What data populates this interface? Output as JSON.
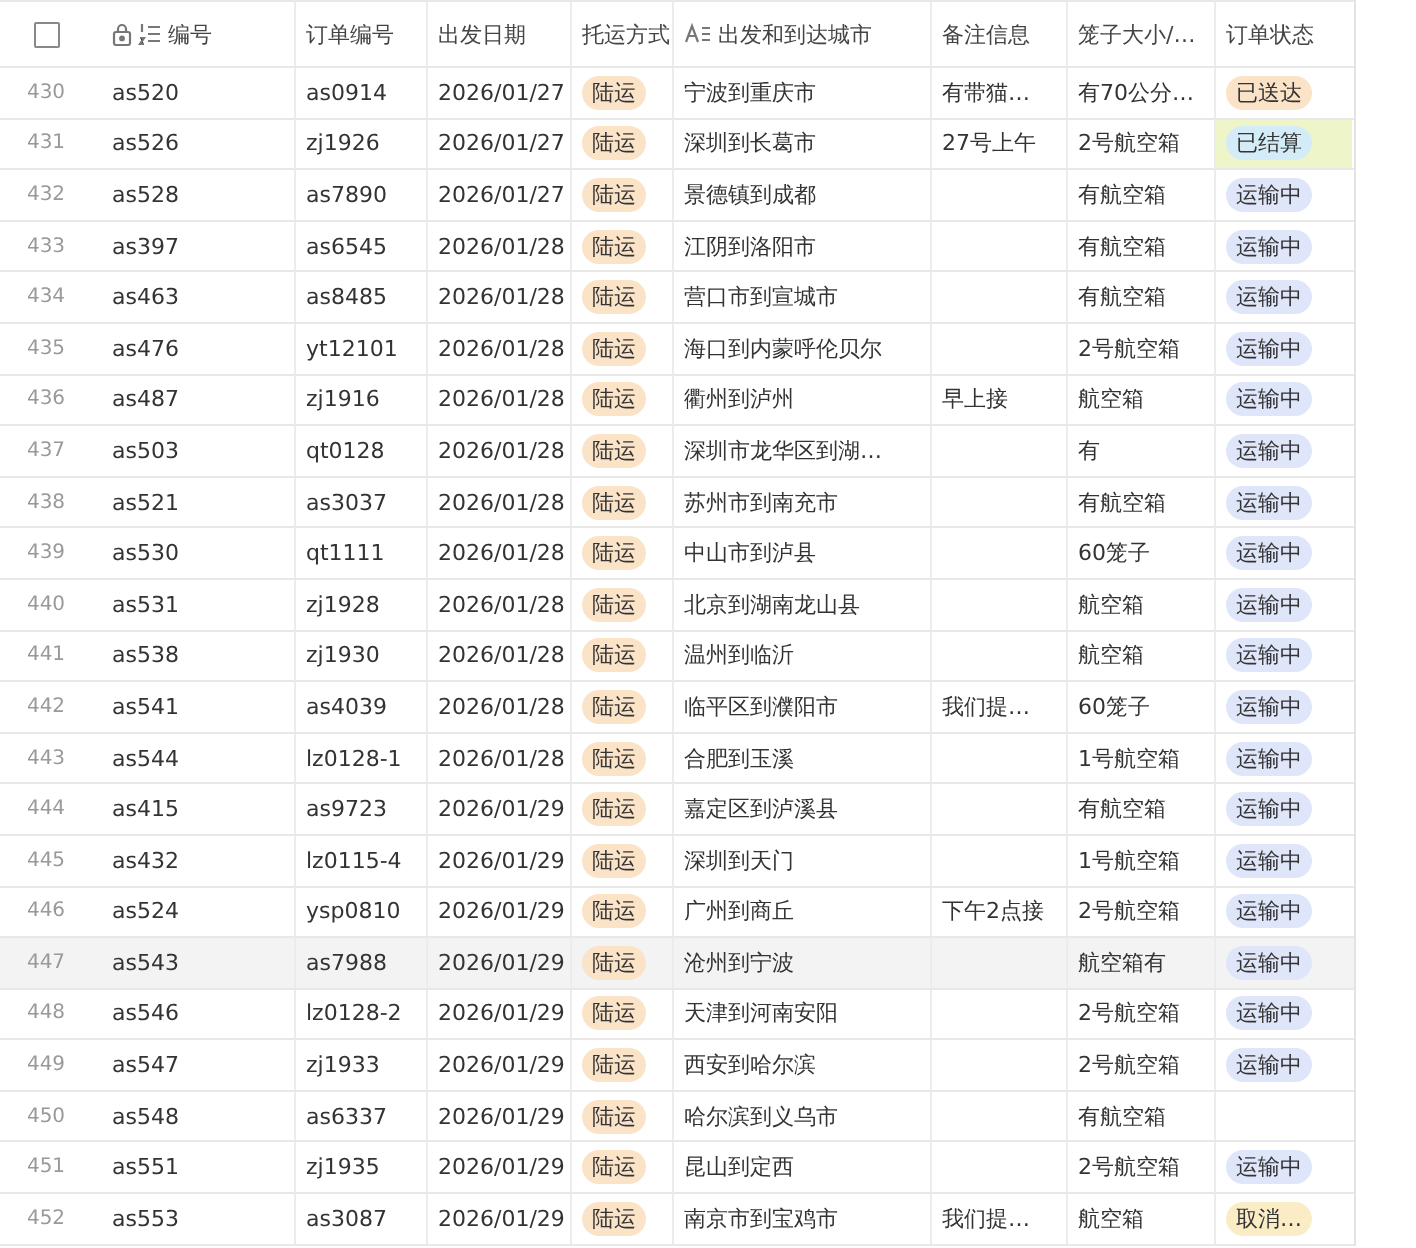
{
  "table": {
    "columns": [
      {
        "label": "编号",
        "kind": "number"
      },
      {
        "label": "订单编号",
        "kind": "plain"
      },
      {
        "label": "出发日期",
        "kind": "plain"
      },
      {
        "label": "托运方式",
        "kind": "plain"
      },
      {
        "label": "出发和到达城市",
        "kind": "text"
      },
      {
        "label": "备注信息",
        "kind": "plain"
      },
      {
        "label": "笼子大小/…",
        "kind": "plain"
      },
      {
        "label": "订单状态",
        "kind": "plain"
      }
    ],
    "header_checkbox": {
      "checked": false
    },
    "rows": [
      {
        "index": "430",
        "id": "as520",
        "order": "as0914",
        "date": "2026/01/27",
        "method": "陆运",
        "route": "宁波到重庆市",
        "note": "有带猫…",
        "cage": "有70公分…",
        "status": {
          "label": "已送达",
          "color": "#fbe3c8",
          "highlighted": false
        },
        "hovered": false
      },
      {
        "index": "431",
        "id": "as526",
        "order": "zj1926",
        "date": "2026/01/27",
        "method": "陆运",
        "route": "深圳到长葛市",
        "note": "27号上午",
        "cage": "2号航空箱",
        "status": {
          "label": "已结算",
          "color": "#d4ecf7",
          "highlighted": true
        },
        "hovered": false
      },
      {
        "index": "432",
        "id": "as528",
        "order": "as7890",
        "date": "2026/01/27",
        "method": "陆运",
        "route": "景德镇到成都",
        "cage": "有航空箱",
        "status": {
          "label": "运输中",
          "color": "#dfe6fa",
          "highlighted": false
        },
        "hovered": false
      },
      {
        "index": "433",
        "id": "as397",
        "order": "as6545",
        "date": "2026/01/28",
        "method": "陆运",
        "route": "江阴到洛阳市",
        "cage": "有航空箱",
        "status": {
          "label": "运输中",
          "color": "#dfe6fa",
          "highlighted": false
        },
        "hovered": false
      },
      {
        "index": "434",
        "id": "as463",
        "order": "as8485",
        "date": "2026/01/28",
        "method": "陆运",
        "route": "营口市到宣城市",
        "cage": "有航空箱",
        "status": {
          "label": "运输中",
          "color": "#dfe6fa",
          "highlighted": false
        },
        "hovered": false
      },
      {
        "index": "435",
        "id": "as476",
        "order": "yt12101",
        "date": "2026/01/28",
        "method": "陆运",
        "route": "海口到内蒙呼伦贝尔",
        "cage": "2号航空箱",
        "status": {
          "label": "运输中",
          "color": "#dfe6fa",
          "highlighted": false
        },
        "hovered": false
      },
      {
        "index": "436",
        "id": "as487",
        "order": "zj1916",
        "date": "2026/01/28",
        "method": "陆运",
        "route": "衢州到泸州",
        "note": "早上接",
        "cage": "航空箱",
        "status": {
          "label": "运输中",
          "color": "#dfe6fa",
          "highlighted": false
        },
        "hovered": false
      },
      {
        "index": "437",
        "id": "as503",
        "order": "qt0128",
        "date": "2026/01/28",
        "method": "陆运",
        "route": "深圳市龙华区到湖…",
        "cage": "有",
        "status": {
          "label": "运输中",
          "color": "#dfe6fa",
          "highlighted": false
        },
        "hovered": false
      },
      {
        "index": "438",
        "id": "as521",
        "order": "as3037",
        "date": "2026/01/28",
        "method": "陆运",
        "route": "苏州市到南充市",
        "cage": "有航空箱",
        "status": {
          "label": "运输中",
          "color": "#dfe6fa",
          "highlighted": false
        },
        "hovered": false
      },
      {
        "index": "439",
        "id": "as530",
        "order": "qt1111",
        "date": "2026/01/28",
        "method": "陆运",
        "route": "中山市到泸县",
        "cage": "60笼子",
        "status": {
          "label": "运输中",
          "color": "#dfe6fa",
          "highlighted": false
        },
        "hovered": false
      },
      {
        "index": "440",
        "id": "as531",
        "order": "zj1928",
        "date": "2026/01/28",
        "method": "陆运",
        "route": "北京到湖南龙山县",
        "cage": "航空箱",
        "status": {
          "label": "运输中",
          "color": "#dfe6fa",
          "highlighted": false
        },
        "hovered": false
      },
      {
        "index": "441",
        "id": "as538",
        "order": "zj1930",
        "date": "2026/01/28",
        "method": "陆运",
        "route": "温州到临沂",
        "cage": "航空箱",
        "status": {
          "label": "运输中",
          "color": "#dfe6fa",
          "highlighted": false
        },
        "hovered": false
      },
      {
        "index": "442",
        "id": "as541",
        "order": "as4039",
        "date": "2026/01/28",
        "method": "陆运",
        "route": "临平区到濮阳市",
        "note": "我们提…",
        "cage": "60笼子",
        "status": {
          "label": "运输中",
          "color": "#dfe6fa",
          "highlighted": false
        },
        "hovered": false
      },
      {
        "index": "443",
        "id": "as544",
        "order": "lz0128-1",
        "date": "2026/01/28",
        "method": "陆运",
        "route": "合肥到玉溪",
        "cage": "1号航空箱",
        "status": {
          "label": "运输中",
          "color": "#dfe6fa",
          "highlighted": false
        },
        "hovered": false
      },
      {
        "index": "444",
        "id": "as415",
        "order": "as9723",
        "date": "2026/01/29",
        "method": "陆运",
        "route": "嘉定区到泸溪县",
        "cage": "有航空箱",
        "status": {
          "label": "运输中",
          "color": "#dfe6fa",
          "highlighted": false
        },
        "hovered": false
      },
      {
        "index": "445",
        "id": "as432",
        "order": "lz0115-4",
        "date": "2026/01/29",
        "method": "陆运",
        "route": "深圳到天门",
        "cage": "1号航空箱",
        "status": {
          "label": "运输中",
          "color": "#dfe6fa",
          "highlighted": false
        },
        "hovered": false
      },
      {
        "index": "446",
        "id": "as524",
        "order": "ysp0810",
        "date": "2026/01/29",
        "method": "陆运",
        "route": "广州到商丘",
        "note": "下午2点接",
        "cage": "2号航空箱",
        "status": {
          "label": "运输中",
          "color": "#dfe6fa",
          "highlighted": false
        },
        "hovered": false
      },
      {
        "index": "447",
        "id": "as543",
        "order": "as7988",
        "date": "2026/01/29",
        "method": "陆运",
        "route": "沧州到宁波",
        "cage": "航空箱有",
        "status": {
          "label": "运输中",
          "color": "#dfe6fa",
          "highlighted": false
        },
        "hovered": true
      },
      {
        "index": "448",
        "id": "as546",
        "order": "lz0128-2",
        "date": "2026/01/29",
        "method": "陆运",
        "route": "天津到河南安阳",
        "cage": "2号航空箱",
        "status": {
          "label": "运输中",
          "color": "#dfe6fa",
          "highlighted": false
        },
        "hovered": false
      },
      {
        "index": "449",
        "id": "as547",
        "order": "zj1933",
        "date": "2026/01/29",
        "method": "陆运",
        "route": "西安到哈尔滨",
        "cage": "2号航空箱",
        "status": {
          "label": "运输中",
          "color": "#dfe6fa",
          "highlighted": false
        },
        "hovered": false
      },
      {
        "index": "450",
        "id": "as548",
        "order": "as6337",
        "date": "2026/01/29",
        "method": "陆运",
        "route": "哈尔滨到义乌市",
        "cage": "有航空箱",
        "hovered": false
      },
      {
        "index": "451",
        "id": "as551",
        "order": "zj1935",
        "date": "2026/01/29",
        "method": "陆运",
        "route": "昆山到定西",
        "cage": "2号航空箱",
        "status": {
          "label": "运输中",
          "color": "#dfe6fa",
          "highlighted": false
        },
        "hovered": false
      },
      {
        "index": "452",
        "id": "as553",
        "order": "as3087",
        "date": "2026/01/29",
        "method": "陆运",
        "route": "南京市到宝鸡市",
        "note": "我们提…",
        "cage": "航空箱",
        "status": {
          "label": "取消…",
          "color": "#faecc4",
          "highlighted": false
        },
        "hovered": false
      }
    ]
  }
}
